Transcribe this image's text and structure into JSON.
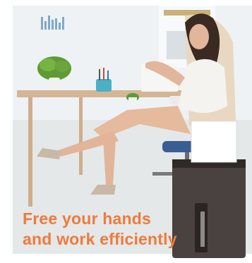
{
  "caption": {
    "line1": "Free your hands",
    "line2": "and work efficiently"
  },
  "colors": {
    "caption": "#f07a3a",
    "wall": "#eef2f4",
    "floor": "#e6e9ea",
    "shredder_body": "#4a4240",
    "paper": "#ffffff"
  }
}
